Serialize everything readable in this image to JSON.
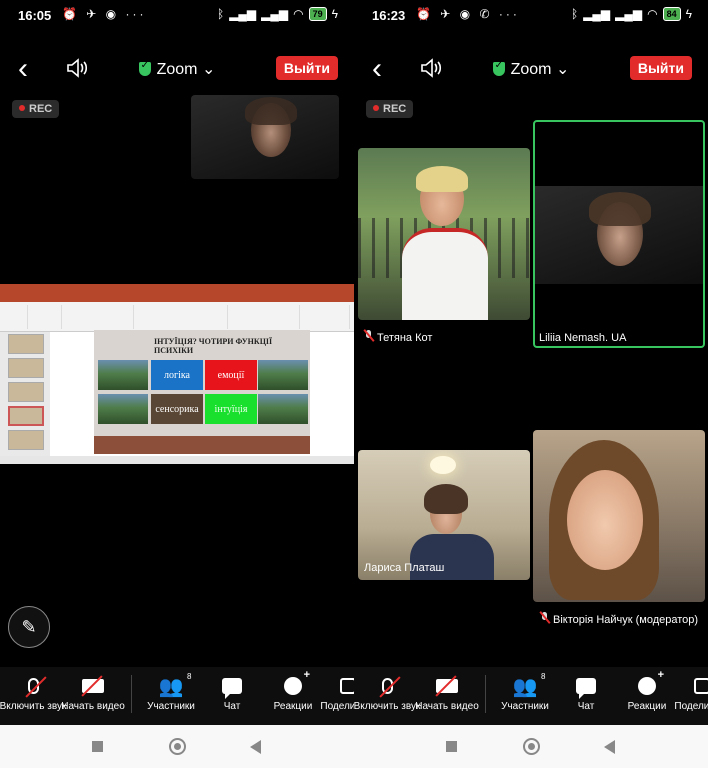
{
  "left": {
    "status": {
      "time": "16:05",
      "icons_left": "⏰ ✈ ◉ ···",
      "battery": "79"
    },
    "topbar": {
      "app_name": "Zoom",
      "leave_label": "Выйти"
    },
    "rec_label": "REC",
    "slide": {
      "title": "ІНТУЇЦІЯ? ЧОТИРИ ФУНКЦІЇ ПСИХІКИ",
      "boxes": [
        {
          "label": "логіка",
          "color": "#1a73c7"
        },
        {
          "label": "емоції",
          "color": "#e8141b"
        },
        {
          "label": "сенсорика",
          "color": "#5a4634"
        },
        {
          "label": "інтуїція",
          "color": "#19e02c"
        }
      ]
    },
    "toolbar": {
      "unmute": "Включить звук",
      "start_video": "Начать видео",
      "participants": "Участники",
      "participants_count": "8",
      "chat": "Чат",
      "reactions": "Реакции",
      "share": "Поделиться"
    }
  },
  "right": {
    "status": {
      "time": "16:23",
      "icons_left": "⏰ ✈ ◉ ✆ ···",
      "battery": "84"
    },
    "topbar": {
      "app_name": "Zoom",
      "leave_label": "Выйти"
    },
    "rec_label": "REC",
    "participants": [
      {
        "name": "Тетяна Кот",
        "muted": true
      },
      {
        "name": "Liliia Nemash. UA",
        "muted": false
      },
      {
        "name": "Лариса Платаш",
        "muted": false
      },
      {
        "name": "Вікторія Найчук (модератор)",
        "muted": true
      }
    ],
    "toolbar": {
      "unmute": "Включить звук",
      "start_video": "Начать видео",
      "participants": "Участники",
      "participants_count": "8",
      "chat": "Чат",
      "reactions": "Реакции",
      "share": "Поделиться"
    }
  },
  "colors": {
    "leave": "#e22c2c",
    "active_speaker": "#38c560",
    "shield": "#38c560"
  }
}
